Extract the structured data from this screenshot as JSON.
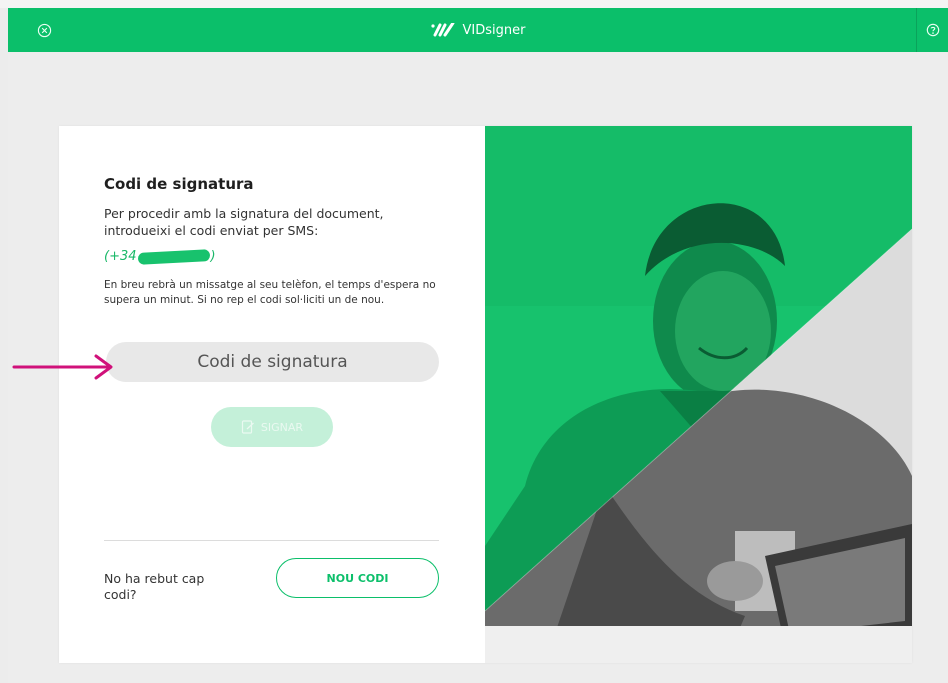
{
  "header": {
    "brand_name": "VIDsigner",
    "close_icon": "close-circle-icon",
    "help_icon": "help-circle-icon"
  },
  "form": {
    "title": "Codi de signatura",
    "description": "Per procedir amb la signatura del document, introdueixi el codi enviat per SMS:",
    "phone_prefix": "(+34",
    "phone_suffix": ")",
    "note": "En breu rebrà un missatge al seu telèfon, el temps d'espera no supera un minut. Si no rep el codi sol·liciti un de nou.",
    "code_placeholder": "Codi de signatura",
    "sign_label": "SIGNAR",
    "no_code_text": "No ha rebut cap codi?",
    "new_code_label": "NOU CODI"
  },
  "colors": {
    "brand_green": "#0bbf6a",
    "disabled_green": "#c4f0d9",
    "annotation_arrow": "#d0117a"
  }
}
